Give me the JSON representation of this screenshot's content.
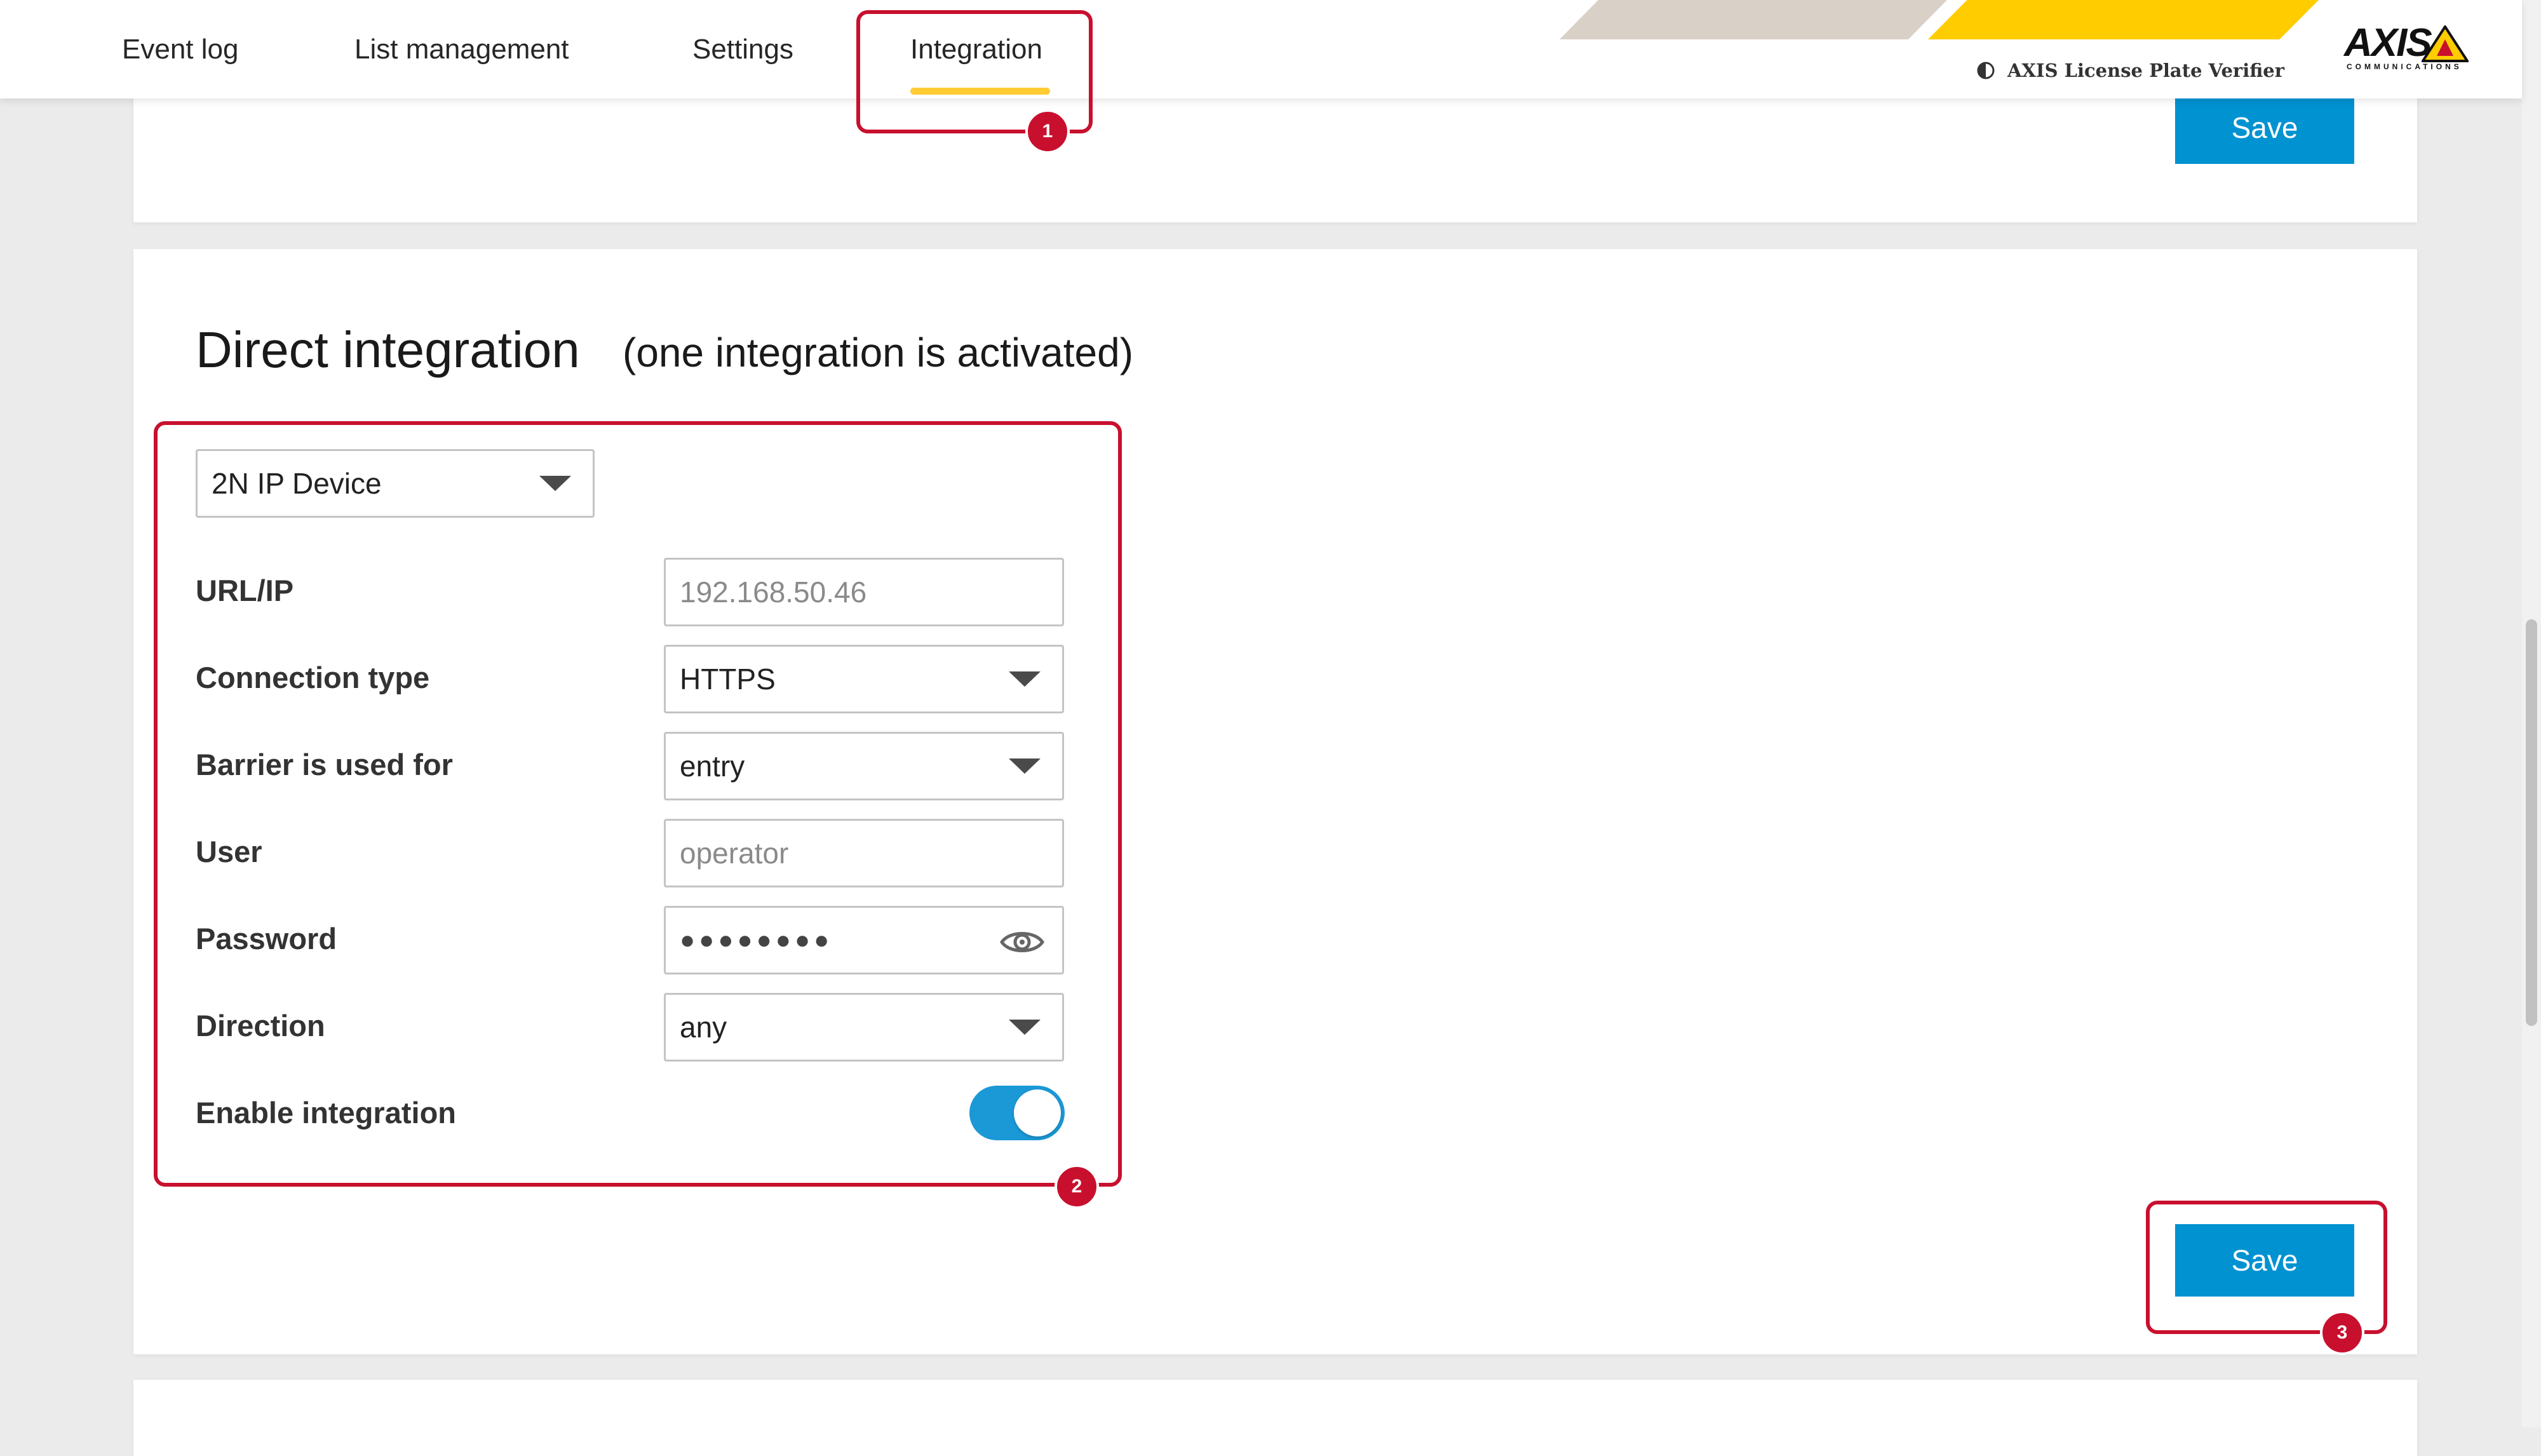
{
  "nav": {
    "tabs": [
      {
        "label": "Event log"
      },
      {
        "label": "List management"
      },
      {
        "label": "Settings"
      },
      {
        "label": "Integration",
        "active": true
      }
    ]
  },
  "brand": {
    "product_name": "AXIS License Plate Verifier",
    "logo_text": "AXIS",
    "logo_subtext": "COMMUNICATIONS",
    "accent_color": "#ffcc33",
    "primary_button_color": "#0092d1",
    "annotation_color": "#c8102e"
  },
  "top_card": {
    "save_label": "Save"
  },
  "direct_integration": {
    "title": "Direct integration",
    "subtitle": "(one integration is activated)",
    "device_select": {
      "value": "2N IP Device"
    },
    "fields": {
      "url_ip": {
        "label": "URL/IP",
        "placeholder": "192.168.50.46"
      },
      "connection_type": {
        "label": "Connection type",
        "value": "HTTPS"
      },
      "barrier": {
        "label": "Barrier is used for",
        "value": "entry"
      },
      "user": {
        "label": "User",
        "placeholder": "operator"
      },
      "password": {
        "label": "Password",
        "masked_value": "●●●●●●●●"
      },
      "direction": {
        "label": "Direction",
        "value": "any"
      },
      "enable": {
        "label": "Enable integration",
        "enabled": true
      }
    },
    "save_label": "Save"
  },
  "annotations": {
    "badge1": "1",
    "badge2": "2",
    "badge3": "3"
  }
}
